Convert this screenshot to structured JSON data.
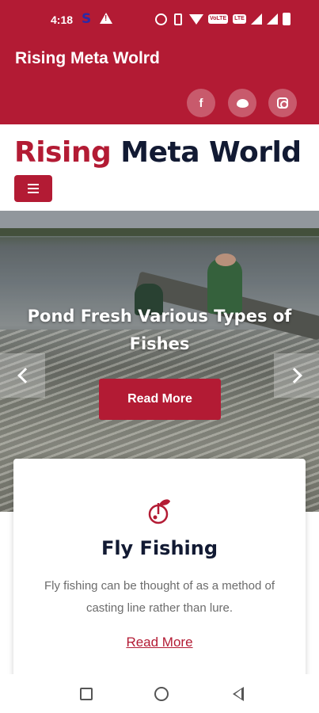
{
  "status_bar": {
    "time": "4:18",
    "app_letter": "S",
    "network_chip_1": "VoLTE",
    "network_chip_2": "LTE"
  },
  "app_bar": {
    "title": "Rising Meta Wolrd"
  },
  "social": [
    {
      "icon": "facebook-icon",
      "glyph": "f"
    },
    {
      "icon": "twitter-icon"
    },
    {
      "icon": "instagram-icon"
    }
  ],
  "brand": {
    "part1": "Rising",
    "part2": "Meta World"
  },
  "hero": {
    "title": "Pond Fresh Various Types of Fishes",
    "button_label": "Read More"
  },
  "card": {
    "title": "Fly Fishing",
    "text": "Fly fishing can be thought of as a method of casting line rather than lure.",
    "link_label": "Read More"
  },
  "colors": {
    "accent": "#b31b34",
    "dark": "#121a33"
  }
}
